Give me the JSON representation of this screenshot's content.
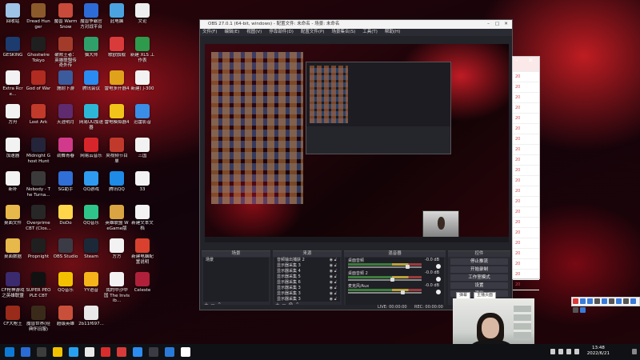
{
  "desktop_icons": [
    {
      "label": "回收站",
      "color": "#9ec3e6"
    },
    {
      "label": "Dread Hunger",
      "color": "#8b5a2b"
    },
    {
      "label": "魔兽 Warm Snow",
      "color": "#c84a3a"
    },
    {
      "label": "魔兽争霸官方对战平台",
      "color": "#2d6bd6"
    },
    {
      "label": "此电脑",
      "color": "#4aa3df"
    },
    {
      "label": "文论",
      "color": "#eeeeee"
    },
    {
      "label": "GESKING",
      "color": "#1c3b6e"
    },
    {
      "label": "Ghostwire Tokyo",
      "color": "#1f1f1f"
    },
    {
      "label": "破败王者：英雄联盟传奇外传",
      "color": "#a33b2b"
    },
    {
      "label": "猫大师",
      "color": "#2fa06a"
    },
    {
      "label": "歌欧旗舰",
      "color": "#d93a3a"
    },
    {
      "label": "新建 XLS 工作表",
      "color": "#2e9a4b"
    },
    {
      "label": "Extra Rcre...",
      "color": "#f2f2f2"
    },
    {
      "label": "God of War",
      "color": "#b02b20"
    },
    {
      "label": "施耐下游",
      "color": "#3b5b9d"
    },
    {
      "label": "腾讯会议",
      "color": "#2a8cf0"
    },
    {
      "label": "雷电多开器4",
      "color": "#e0a21b"
    },
    {
      "label": "新建门-300",
      "color": "#f2f2f2"
    },
    {
      "label": "方舟",
      "color": "#f2f2f2"
    },
    {
      "label": "Lost Ark",
      "color": "#c13a2a"
    },
    {
      "label": "天涯明月",
      "color": "#5f2a6e"
    },
    {
      "label": "网易UU加速器",
      "color": "#2eb6d6"
    },
    {
      "label": "雷电模拟器4",
      "color": "#f0c419"
    },
    {
      "label": "迅雷影音",
      "color": "#3a8ee6"
    },
    {
      "label": "加速器",
      "color": "#f2f2f2"
    },
    {
      "label": "Midnight Ghost Hunt",
      "color": "#24243a"
    },
    {
      "label": "劲舞青春",
      "color": "#d13a8a"
    },
    {
      "label": "网易云音乐",
      "color": "#d7262b"
    },
    {
      "label": "央视频节目单",
      "color": "#c0392b"
    },
    {
      "label": "三国",
      "color": "#f2f2f2"
    },
    {
      "label": "新补",
      "color": "#f2f2f2"
    },
    {
      "label": "Nobody - The Turna...",
      "color": "#3a3a3a"
    },
    {
      "label": "SG助手",
      "color": "#2f6fd6"
    },
    {
      "label": "QQ游戏",
      "color": "#2f9bf0"
    },
    {
      "label": "腾讯QQ",
      "color": "#1e8be6"
    },
    {
      "label": "33",
      "color": "#f2f2f2"
    },
    {
      "label": "桌面文件",
      "color": "#e7b84a"
    },
    {
      "label": "Overprime CBT (Clos...",
      "color": "#272727"
    },
    {
      "label": "DoDo",
      "color": "#ffd54a"
    },
    {
      "label": "QQ音乐",
      "color": "#2fc58a"
    },
    {
      "label": "英雄联盟 WeGame版",
      "color": "#d9a441"
    },
    {
      "label": "新建文本文档",
      "color": "#f2f2f2"
    },
    {
      "label": "桌面数据",
      "color": "#e7b84a"
    },
    {
      "label": "Propnight",
      "color": "#1f1f1f"
    },
    {
      "label": "OBS Studio",
      "color": "#3b3b46"
    },
    {
      "label": "Steam",
      "color": "#1b2838"
    },
    {
      "label": "方方",
      "color": "#f2f2f2"
    },
    {
      "label": "新建电脑配置说明",
      "color": "#d9412e"
    },
    {
      "label": "CF枪神游戏之英雄联盟",
      "color": "#3b2a6e"
    },
    {
      "label": "SUPER PEOPLE CBT",
      "color": "#111111"
    },
    {
      "label": "QQ音乐",
      "color": "#f2c200"
    },
    {
      "label": "YY语音",
      "color": "#f5b41a"
    },
    {
      "label": "我的中沙中国 The Invisib...",
      "color": "#f2f2f2"
    },
    {
      "label": "Celeste",
      "color": "#b0203a"
    },
    {
      "label": "CF大枪王",
      "color": "#9a2a1a"
    },
    {
      "label": "魔兽世界(经典怀旧服)",
      "color": "#3a2a1a"
    },
    {
      "label": "超级英雄",
      "color": "#c8503a"
    },
    {
      "label": "2b11f697...",
      "color": "#e8e8e8"
    }
  ],
  "obs": {
    "title": "OBS 27.0.1 (64-bit, windows) - 配置文件: 未命名 - 场景: 未命名",
    "menu": [
      "文件(F)",
      "编辑(E)",
      "视图(V)",
      "停靠部件(D)",
      "配置文件(P)",
      "场景集合(S)",
      "工具(T)",
      "帮助(H)"
    ],
    "scenes_header": "场景",
    "scenes": [
      "场景"
    ],
    "sources_header": "来源",
    "sources": [
      "音频输出捕获 2",
      "显示器采集 3",
      "显示器采集 4",
      "显示器采集 5",
      "显示器采集 6",
      "显示器采集 3",
      "显示器采集 3",
      "显示器采集 3"
    ],
    "mixer_header": "混音器",
    "mixer": [
      {
        "name": "桌面音频",
        "db": "-0.0 dB",
        "level": 0.82
      },
      {
        "name": "桌面音频 2",
        "db": "-0.0 dB",
        "level": 0.6
      },
      {
        "name": "麦克风/Aux",
        "db": "-0.0 dB",
        "level": 0.75
      }
    ],
    "controls_header": "控件",
    "controls": [
      "停止推流",
      "开始录制",
      "工作室模式",
      "设置",
      "退出"
    ],
    "status": {
      "live": "LIVE: 00:00:00",
      "rec": "REC: 00:00:00"
    }
  },
  "side_window_rows": [
    "20",
    "20",
    "20",
    "20",
    "20",
    "20",
    "20",
    "20",
    "20",
    "20",
    "20",
    "20",
    "20",
    "20",
    "20",
    "20",
    "20",
    "20",
    "20",
    "20",
    "20",
    "20",
    "20"
  ],
  "cam_chips": [
    "弹幕",
    "主播页面"
  ],
  "taskbar": {
    "apps": [
      "#0f7ad6",
      "#2a6bd4",
      "#3d3d3d",
      "#f2c200",
      "#28a0f0",
      "#e8e8e8",
      "#d92c2c",
      "#d93a3a",
      "#2d8cf0",
      "#3b3b46",
      "#2a7bd9",
      "#ffffff"
    ],
    "time": "13:48",
    "date": "2022/6/21"
  }
}
